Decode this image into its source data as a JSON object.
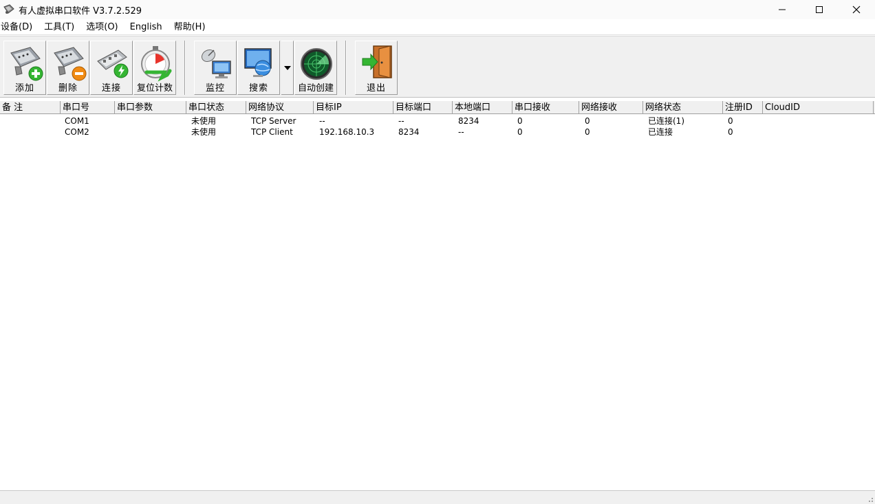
{
  "window": {
    "title": "有人虚拟串口软件 V3.7.2.529",
    "controls": {
      "minimize": "minimize-icon",
      "maximize": "maximize-icon",
      "close": "close-icon"
    }
  },
  "menu": {
    "device": "设备(D)",
    "tools": "工具(T)",
    "options": "选项(O)",
    "english": "English",
    "help": "帮助(H)"
  },
  "toolbar": {
    "add": "添加",
    "delete": "删除",
    "connect": "连接",
    "reset_count": "复位计数",
    "monitor": "监控",
    "search": "搜索",
    "auto_create": "自动创建",
    "exit": "退出"
  },
  "table": {
    "headers": [
      "备 注",
      "串口号",
      "串口参数",
      "串口状态",
      "网络协议",
      "目标IP",
      "目标端口",
      "本地端口",
      "串口接收",
      "网络接收",
      "网络状态",
      "注册ID",
      "CloudID"
    ],
    "rows": [
      [
        "",
        "COM1",
        "",
        "未使用",
        "TCP Server",
        "--",
        "--",
        "8234",
        "0",
        "0",
        "已连接(1)",
        "0",
        ""
      ],
      [
        "",
        "COM2",
        "",
        "未使用",
        "TCP Client",
        "192.168.10.3",
        "8234",
        "--",
        "0",
        "0",
        "已连接",
        "0",
        ""
      ]
    ]
  }
}
